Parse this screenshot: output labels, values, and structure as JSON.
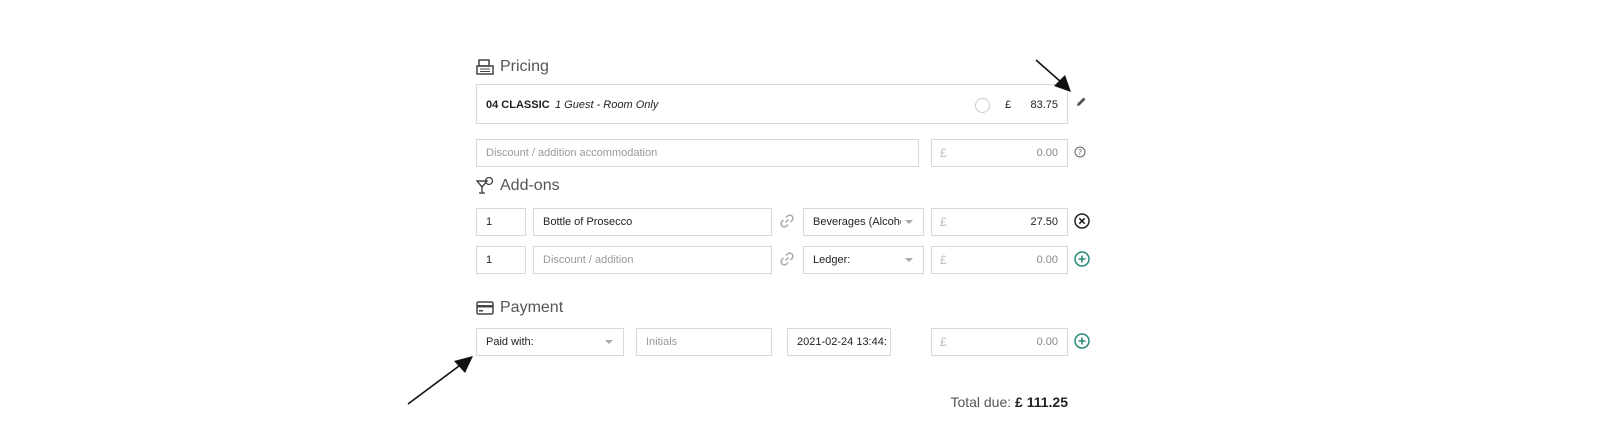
{
  "pricing": {
    "title": "Pricing",
    "room_code": "04 CLASSIC",
    "room_desc": "1 Guest - Room Only",
    "currency": "£",
    "amount": "83.75",
    "discount_placeholder": "Discount / addition accommodation",
    "discount_currency": "£",
    "discount_amount": "0.00"
  },
  "addons": {
    "title": "Add-ons",
    "rows": [
      {
        "qty": "1",
        "name": "Bottle of Prosecco",
        "ledger": "Beverages (Alcoho",
        "currency": "£",
        "amount": "27.50"
      },
      {
        "qty": "1",
        "name_placeholder": "Discount / addition",
        "ledger": "Ledger:",
        "currency": "£",
        "amount": "0.00"
      }
    ]
  },
  "payment": {
    "title": "Payment",
    "paid_with": "Paid with:",
    "initials_placeholder": "Initials",
    "datetime": "2021-02-24 13:44:",
    "currency": "£",
    "amount": "0.00"
  },
  "total": {
    "label": "Total due:",
    "value": "£ 111.25"
  },
  "colors": {
    "accent_green": "#2a8a7a",
    "border": "#d9d9d9"
  },
  "icons": [
    "cash-register-icon",
    "cocktail-icon",
    "credit-card-icon",
    "pencil-icon",
    "help-icon",
    "link-icon",
    "remove-icon",
    "add-icon"
  ]
}
